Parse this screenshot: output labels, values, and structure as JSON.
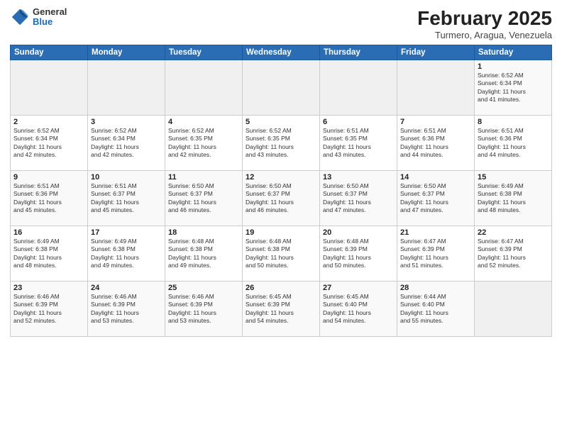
{
  "logo": {
    "general": "General",
    "blue": "Blue"
  },
  "title": "February 2025",
  "subtitle": "Turmero, Aragua, Venezuela",
  "headers": [
    "Sunday",
    "Monday",
    "Tuesday",
    "Wednesday",
    "Thursday",
    "Friday",
    "Saturday"
  ],
  "rows": [
    [
      {
        "day": "",
        "info": ""
      },
      {
        "day": "",
        "info": ""
      },
      {
        "day": "",
        "info": ""
      },
      {
        "day": "",
        "info": ""
      },
      {
        "day": "",
        "info": ""
      },
      {
        "day": "",
        "info": ""
      },
      {
        "day": "1",
        "info": "Sunrise: 6:52 AM\nSunset: 6:34 PM\nDaylight: 11 hours\nand 41 minutes."
      }
    ],
    [
      {
        "day": "2",
        "info": "Sunrise: 6:52 AM\nSunset: 6:34 PM\nDaylight: 11 hours\nand 42 minutes."
      },
      {
        "day": "3",
        "info": "Sunrise: 6:52 AM\nSunset: 6:34 PM\nDaylight: 11 hours\nand 42 minutes."
      },
      {
        "day": "4",
        "info": "Sunrise: 6:52 AM\nSunset: 6:35 PM\nDaylight: 11 hours\nand 42 minutes."
      },
      {
        "day": "5",
        "info": "Sunrise: 6:52 AM\nSunset: 6:35 PM\nDaylight: 11 hours\nand 43 minutes."
      },
      {
        "day": "6",
        "info": "Sunrise: 6:51 AM\nSunset: 6:35 PM\nDaylight: 11 hours\nand 43 minutes."
      },
      {
        "day": "7",
        "info": "Sunrise: 6:51 AM\nSunset: 6:36 PM\nDaylight: 11 hours\nand 44 minutes."
      },
      {
        "day": "8",
        "info": "Sunrise: 6:51 AM\nSunset: 6:36 PM\nDaylight: 11 hours\nand 44 minutes."
      }
    ],
    [
      {
        "day": "9",
        "info": "Sunrise: 6:51 AM\nSunset: 6:36 PM\nDaylight: 11 hours\nand 45 minutes."
      },
      {
        "day": "10",
        "info": "Sunrise: 6:51 AM\nSunset: 6:37 PM\nDaylight: 11 hours\nand 45 minutes."
      },
      {
        "day": "11",
        "info": "Sunrise: 6:50 AM\nSunset: 6:37 PM\nDaylight: 11 hours\nand 46 minutes."
      },
      {
        "day": "12",
        "info": "Sunrise: 6:50 AM\nSunset: 6:37 PM\nDaylight: 11 hours\nand 46 minutes."
      },
      {
        "day": "13",
        "info": "Sunrise: 6:50 AM\nSunset: 6:37 PM\nDaylight: 11 hours\nand 47 minutes."
      },
      {
        "day": "14",
        "info": "Sunrise: 6:50 AM\nSunset: 6:37 PM\nDaylight: 11 hours\nand 47 minutes."
      },
      {
        "day": "15",
        "info": "Sunrise: 6:49 AM\nSunset: 6:38 PM\nDaylight: 11 hours\nand 48 minutes."
      }
    ],
    [
      {
        "day": "16",
        "info": "Sunrise: 6:49 AM\nSunset: 6:38 PM\nDaylight: 11 hours\nand 48 minutes."
      },
      {
        "day": "17",
        "info": "Sunrise: 6:49 AM\nSunset: 6:38 PM\nDaylight: 11 hours\nand 49 minutes."
      },
      {
        "day": "18",
        "info": "Sunrise: 6:48 AM\nSunset: 6:38 PM\nDaylight: 11 hours\nand 49 minutes."
      },
      {
        "day": "19",
        "info": "Sunrise: 6:48 AM\nSunset: 6:38 PM\nDaylight: 11 hours\nand 50 minutes."
      },
      {
        "day": "20",
        "info": "Sunrise: 6:48 AM\nSunset: 6:39 PM\nDaylight: 11 hours\nand 50 minutes."
      },
      {
        "day": "21",
        "info": "Sunrise: 6:47 AM\nSunset: 6:39 PM\nDaylight: 11 hours\nand 51 minutes."
      },
      {
        "day": "22",
        "info": "Sunrise: 6:47 AM\nSunset: 6:39 PM\nDaylight: 11 hours\nand 52 minutes."
      }
    ],
    [
      {
        "day": "23",
        "info": "Sunrise: 6:46 AM\nSunset: 6:39 PM\nDaylight: 11 hours\nand 52 minutes."
      },
      {
        "day": "24",
        "info": "Sunrise: 6:46 AM\nSunset: 6:39 PM\nDaylight: 11 hours\nand 53 minutes."
      },
      {
        "day": "25",
        "info": "Sunrise: 6:46 AM\nSunset: 6:39 PM\nDaylight: 11 hours\nand 53 minutes."
      },
      {
        "day": "26",
        "info": "Sunrise: 6:45 AM\nSunset: 6:39 PM\nDaylight: 11 hours\nand 54 minutes."
      },
      {
        "day": "27",
        "info": "Sunrise: 6:45 AM\nSunset: 6:40 PM\nDaylight: 11 hours\nand 54 minutes."
      },
      {
        "day": "28",
        "info": "Sunrise: 6:44 AM\nSunset: 6:40 PM\nDaylight: 11 hours\nand 55 minutes."
      },
      {
        "day": "",
        "info": ""
      }
    ]
  ]
}
